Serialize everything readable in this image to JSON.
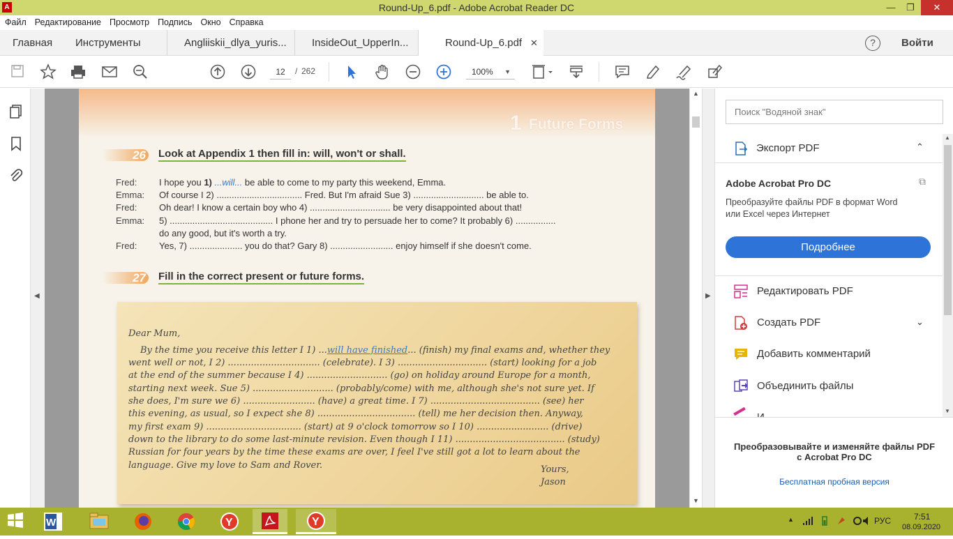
{
  "window": {
    "title": "Round-Up_6.pdf - Adobe Acrobat Reader DC",
    "min": "—",
    "max": "❐",
    "close": "✕"
  },
  "menu": [
    "Файл",
    "Редактирование",
    "Просмотр",
    "Подпись",
    "Окно",
    "Справка"
  ],
  "tabs": {
    "home": "Главная",
    "tools": "Инструменты",
    "docs": [
      "Angliiskii_dlya_yuris...",
      "InsideOut_UpperIn...",
      "Round-Up_6.pdf"
    ],
    "close_icon": "✕",
    "help": "?",
    "signin": "Войти"
  },
  "toolbar": {
    "page_current": "12",
    "page_sep": "/",
    "page_total": "262",
    "zoom": "100%"
  },
  "search": {
    "placeholder": "Поиск \"Водяной знак\""
  },
  "right_pane": {
    "export_label": "Экспорт PDF",
    "promo_title": "Adobe Acrobat Pro DC",
    "promo_text_1": "Преобразуйте файлы PDF в формат Word",
    "promo_text_2": "или Excel через Интернет",
    "more_button": "Подробнее",
    "tools": [
      "Редактировать PDF",
      "Создать PDF",
      "Добавить комментарий",
      "Объединить файлы"
    ],
    "partial_tool": "И",
    "footer_1": "Преобразовывайте и изменяйте файлы PDF",
    "footer_2": "с Acrobat Pro DC",
    "trial_link": "Бесплатная пробная версия",
    "colors": {
      "button": "#2d73d8",
      "link": "#1a5fb4"
    }
  },
  "pdf": {
    "header_num": "1",
    "header_text": "Future Forms",
    "ex26": {
      "num": "26",
      "title": "Look at Appendix 1 then fill in: will, won't or shall.",
      "lines": [
        {
          "speaker": "Fred:",
          "text_a": "I hope you ",
          "num": "1)",
          "fill": " ...will... ",
          "text_b": "be able to come to my party this weekend, Emma."
        },
        {
          "speaker": "Emma:",
          "text": "Of course I 2) .................................. Fred. But I'm afraid Sue 3) ............................ be able to."
        },
        {
          "speaker": "Fred:",
          "text": "Oh dear! I know a certain boy who 4) ................................ be very disappointed about that!"
        },
        {
          "speaker": "Emma:",
          "text": "5) ......................................... I phone her and try to persuade her to come? It probably 6) ................"
        },
        {
          "speaker": "",
          "text": "do any good, but it's worth a try."
        },
        {
          "speaker": "Fred:",
          "text": "Yes, 7) ..................... you do that? Gary 8) ......................... enjoy himself if she doesn't come."
        }
      ]
    },
    "ex27": {
      "num": "27",
      "title": "Fill in the correct present or future forms.",
      "letter": {
        "greeting": "Dear Mum,",
        "line1_a": "By the time you receive this letter I 1) ...",
        "line1_fill": "will have finished",
        "line1_b": "... (finish) my final exams and, whether they",
        "lines": [
          "went well or not, I 2) ................................ (celebrate). I 3) ............................... (start) looking for a job",
          "at the end of the summer because I 4) ............................ (go) on holiday around Europe for a month,",
          "starting next week. Sue 5) ............................ (probably/come) with me, although she's not sure yet. If",
          "she does, I'm sure we 6) ......................... (have) a great time. I 7) ...................................... (see) her",
          "this evening, as usual, so I expect she 8) .................................. (tell) me her decision then. Anyway,",
          "my first exam 9) ................................. (start) at 9 o'clock tomorrow so I 10) ......................... (drive)",
          "down to the library to do some last-minute revision. Even though I 11) ...................................... (study)",
          "Russian for four years by the time these exams are over, I feel I've still got a lot to learn about the",
          "language. Give my love to Sam and Rover."
        ],
        "sign_1": "Yours,",
        "sign_2": "Jason"
      }
    }
  },
  "taskbar": {
    "lang": "РУС",
    "time": "7:51",
    "date": "08.09.2020"
  }
}
